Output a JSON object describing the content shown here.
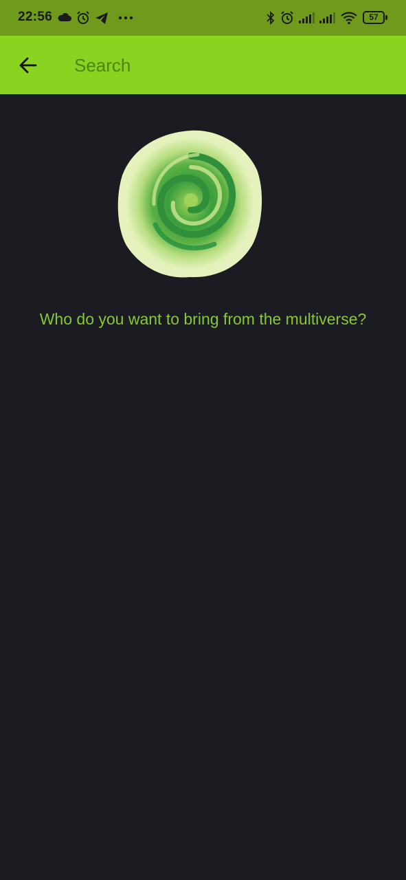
{
  "status_bar": {
    "time": "22:56",
    "battery": "57",
    "left_icons": [
      "cloud-icon",
      "alarm-icon",
      "telegram-icon",
      "more-dots-icon"
    ],
    "right_icons": [
      "bluetooth-icon",
      "alarm-icon",
      "signal-icon",
      "signal-icon",
      "wifi-icon",
      "battery-icon"
    ]
  },
  "app_bar": {
    "back_icon": "arrow-left-icon",
    "search": {
      "placeholder": "Search",
      "value": ""
    }
  },
  "main": {
    "portal_image": "portal-swirl-image",
    "prompt": "Who do you want to bring from the multiverse?"
  },
  "colors": {
    "status_bar_bg": "#6f9a1c",
    "app_bar_bg": "#89d321",
    "background": "#1b1c22",
    "accent_text": "#86c735"
  }
}
